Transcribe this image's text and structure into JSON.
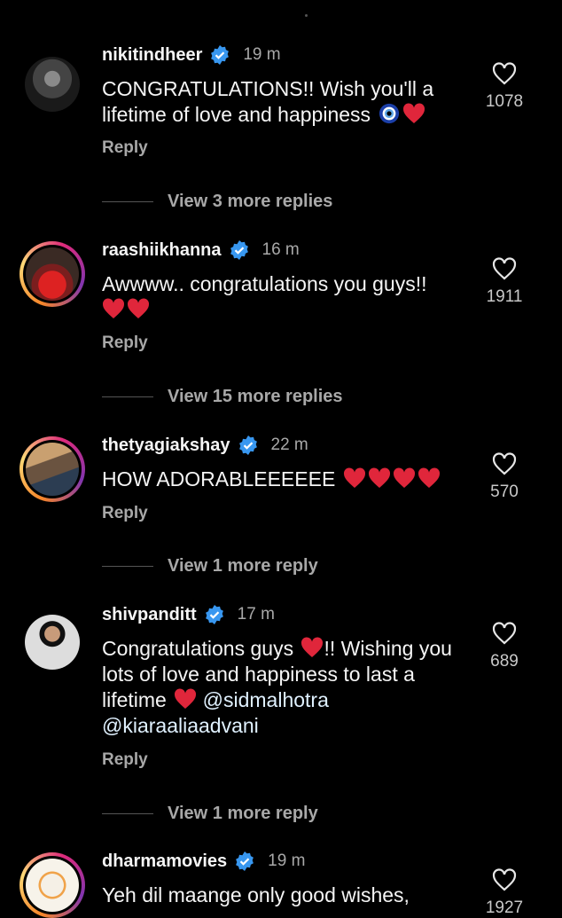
{
  "comments": [
    {
      "username": "nikitindheer",
      "time": "19 m",
      "text": "CONGRATULATIONS!! Wish you'll a lifetime of love and happiness",
      "likes": "1078",
      "reply_label": "Reply",
      "view_more": "View 3 more replies",
      "emojis": [
        "nazar-amulet",
        "red-heart"
      ]
    },
    {
      "username": "raashiikhanna",
      "time": "16 m",
      "text": "Awwww.. congratulations you guys!!",
      "likes": "1911",
      "reply_label": "Reply",
      "view_more": "View 15 more replies",
      "emojis": [
        "red-heart",
        "red-heart"
      ]
    },
    {
      "username": "thetyagiakshay",
      "time": "22 m",
      "text": "HOW ADORABLEEEEEE",
      "likes": "570",
      "reply_label": "Reply",
      "view_more": "View 1 more reply",
      "emojis": [
        "red-heart",
        "red-heart",
        "red-heart",
        "red-heart"
      ]
    },
    {
      "username": "shivpanditt",
      "time": "17 m",
      "text_part1": "Congratulations guys",
      "text_part2": "!! Wishing you lots of love and happiness to last a lifetime",
      "mention1": "@sidmalhotra",
      "mention2": "@kiaraaliaadvani",
      "likes": "689",
      "reply_label": "Reply",
      "view_more": "View 1 more reply",
      "emojis": [
        "red-heart",
        "red-heart"
      ]
    },
    {
      "username": "dharmamovies",
      "time": "19 m",
      "text": "Yeh dil maange only good wishes,",
      "likes": "1927"
    }
  ],
  "colors": {
    "background": "#000000",
    "verified": "#3897f0",
    "secondary_text": "#a8a8a8",
    "heart_emoji": "#e0263b"
  }
}
